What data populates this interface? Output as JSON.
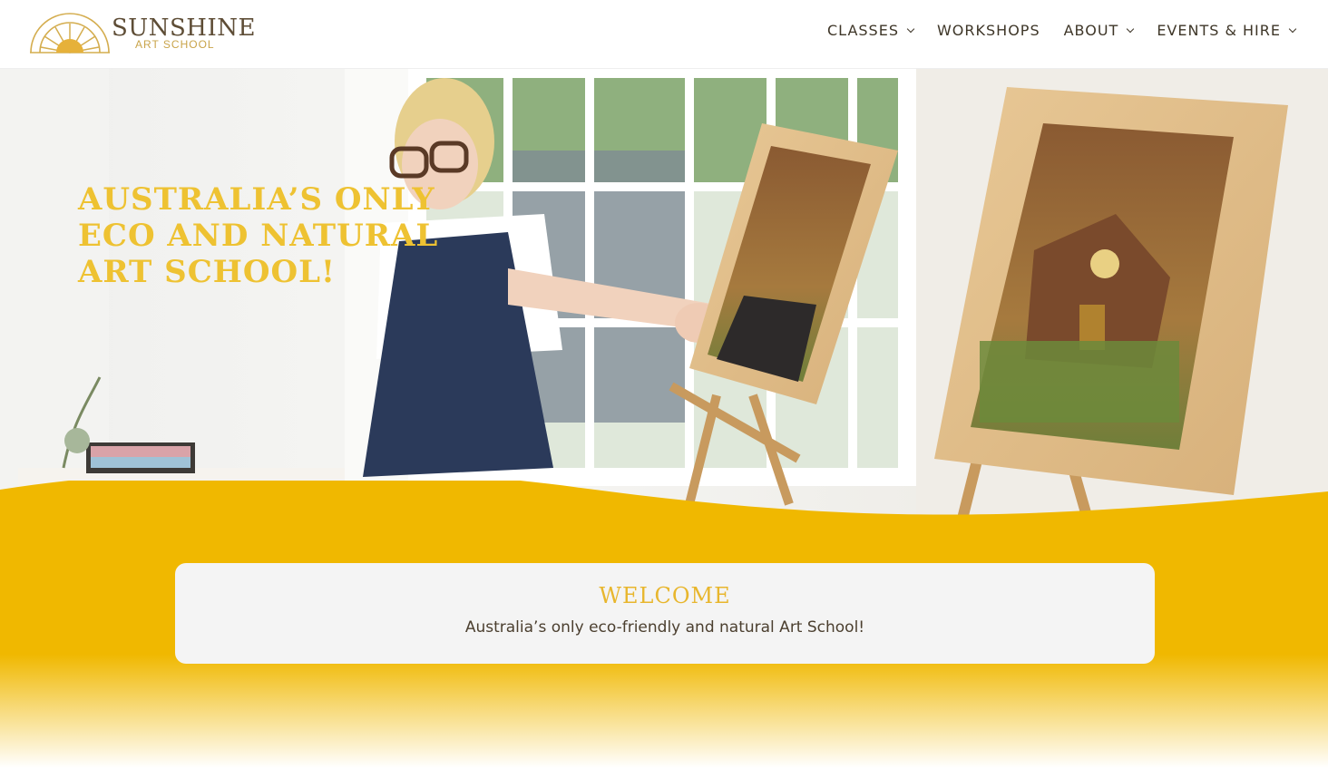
{
  "brand": {
    "name": "SUNSHINE",
    "sub": "ART SCHOOL",
    "logo_icon": "sun-arch-icon"
  },
  "nav": {
    "items": [
      {
        "label": "CLASSES",
        "has_dropdown": true
      },
      {
        "label": "WORKSHOPS",
        "has_dropdown": false
      },
      {
        "label": "ABOUT",
        "has_dropdown": true
      },
      {
        "label": "EVENTS & HIRE",
        "has_dropdown": true
      }
    ]
  },
  "hero": {
    "headline": "AUSTRALIA’S ONLY ECO AND NATURAL ART SCHOOL!"
  },
  "welcome": {
    "title": "WELCOME",
    "text": "Australia’s only eco-friendly and natural Art School!"
  },
  "colors": {
    "accent_yellow": "#f0b800",
    "headline_yellow": "#eec232",
    "brand_brown": "#5e4d36",
    "card_bg": "#f4f4f4"
  }
}
